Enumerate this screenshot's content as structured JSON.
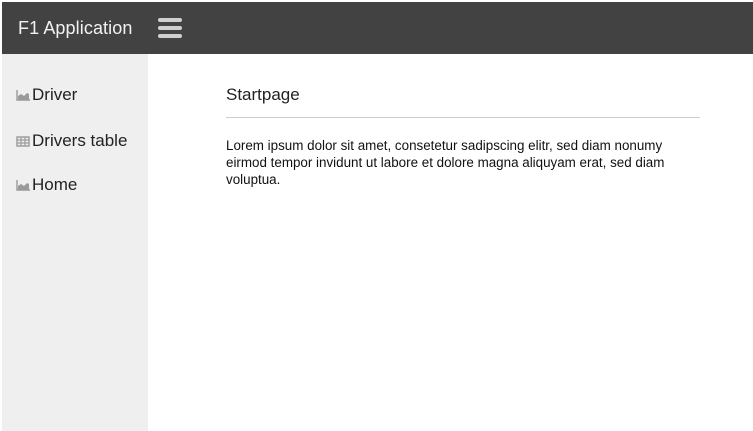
{
  "header": {
    "app_title": "F1 Application",
    "menu_icon": "hamburger-menu-icon",
    "background_color": "#424242"
  },
  "sidebar": {
    "background_color": "#efefef",
    "items": [
      {
        "label": "Driver",
        "icon": "area-chart-icon"
      },
      {
        "label": "Drivers table",
        "icon": "table-icon"
      },
      {
        "label": "Home",
        "icon": "area-chart-icon"
      }
    ]
  },
  "main": {
    "title": "Startpage",
    "body": "Lorem ipsum dolor sit amet, consetetur sadipscing elitr, sed diam nonumy eirmod tempor invidunt ut labore et dolore magna aliquyam erat, sed diam voluptua."
  }
}
